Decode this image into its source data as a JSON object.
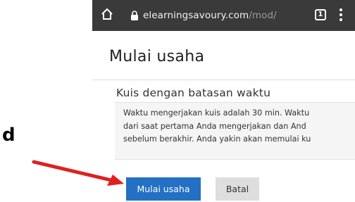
{
  "browser": {
    "url_host": "elearningsavoury.com",
    "url_path": "/mod/",
    "tab_count": "1",
    "icons": [
      "home-icon",
      "lock-icon",
      "tabs-icon",
      "menu-icon"
    ]
  },
  "page": {
    "title": "Mulai usaha",
    "section_heading": "Kuis dengan batasan waktu",
    "info_text": "Waktu mengerjakan kuis adalah 30 min. Waktu\ndari saat pertama Anda mengerjakan dan And\nsebelum berakhir. Anda yakin akan memulai ku",
    "start_button": "Mulai usaha",
    "cancel_button": "Batal"
  },
  "annotation": {
    "label": "d",
    "color": "#e02020"
  },
  "colors": {
    "urlbar": "#3a3a3a",
    "primary_button": "#2370c4",
    "secondary_button": "#dedede"
  }
}
